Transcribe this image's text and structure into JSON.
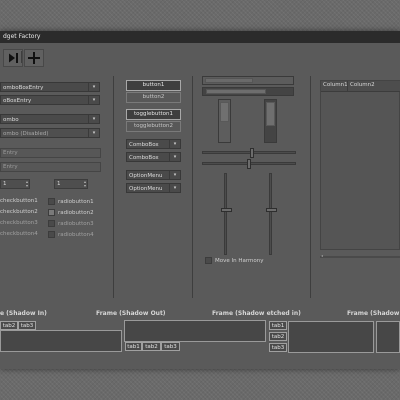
{
  "window": {
    "title": "dget Factory"
  },
  "toolbar": {
    "back_icon": "arrow-left-icon",
    "add_icon": "plus-icon"
  },
  "combos": [
    {
      "label": "omboBoxEntry"
    },
    {
      "label": "oBoxEntry"
    },
    {
      "label": "ombo"
    },
    {
      "label": "ombo (Disabled)"
    }
  ],
  "entries": [
    {
      "value": "Entry"
    },
    {
      "value": "Entry"
    }
  ],
  "spins": [
    {
      "value": "1"
    },
    {
      "value": "1"
    }
  ],
  "checks": [
    {
      "label": "checkbutton1"
    },
    {
      "label": "checkbutton2"
    },
    {
      "label": "checkbutton3"
    },
    {
      "label": "checkbutton4"
    }
  ],
  "radios": [
    {
      "label": "radiobutton1"
    },
    {
      "label": "radiobutton2"
    },
    {
      "label": "radiobutton3"
    },
    {
      "label": "radiobutton4"
    }
  ],
  "buttons": [
    {
      "label": "button1"
    },
    {
      "label": "button2"
    }
  ],
  "toggles": [
    {
      "label": "togglebutton1"
    },
    {
      "label": "togglebutton2"
    }
  ],
  "mid_combos": [
    {
      "label": "ComboBox"
    },
    {
      "label": "ComboBox"
    }
  ],
  "option_menus": [
    {
      "label": "OptionMenu"
    },
    {
      "label": "OptionMenu"
    }
  ],
  "move_harmony": {
    "label": "Move In Harmony"
  },
  "tree": {
    "col1": "Column1",
    "col2": "Column2"
  },
  "frames": [
    {
      "label": "e (Shadow In)"
    },
    {
      "label": "Frame (Shadow Out)"
    },
    {
      "label": "Frame (Shadow etched in)"
    },
    {
      "label": "Frame (Shadow"
    }
  ],
  "tabs_a": [
    {
      "label": "tab2"
    },
    {
      "label": "tab3"
    }
  ],
  "tabs_b": [
    {
      "label": "tab1"
    },
    {
      "label": "tab2"
    },
    {
      "label": "tab3"
    }
  ],
  "tabs_c": [
    {
      "label": "tab1"
    },
    {
      "label": "tab2"
    },
    {
      "label": "tab3"
    }
  ],
  "colors": {
    "window_bg": "#5a5a5a",
    "titlebar": "#2b2b2b",
    "desktop": "#6a6a6a"
  }
}
